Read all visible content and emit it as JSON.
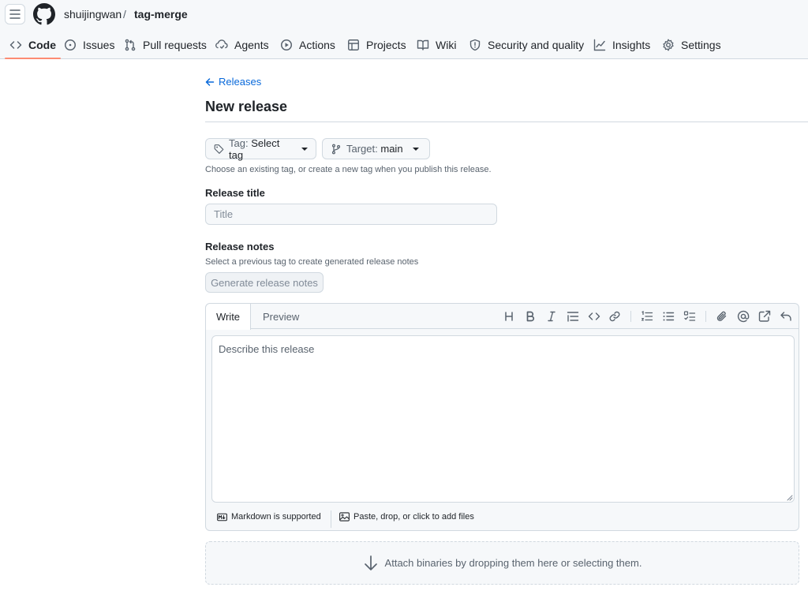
{
  "repo": {
    "owner": "shuijingwan",
    "separator": "/",
    "name": "tag-merge"
  },
  "nav": {
    "tabs": [
      {
        "label": "Code",
        "icon": "code-icon",
        "active": true
      },
      {
        "label": "Issues",
        "icon": "issue-icon"
      },
      {
        "label": "Pull requests",
        "icon": "pull-request-icon"
      },
      {
        "label": "Agents",
        "icon": "agents-icon"
      },
      {
        "label": "Actions",
        "icon": "play-icon"
      },
      {
        "label": "Projects",
        "icon": "table-icon"
      },
      {
        "label": "Wiki",
        "icon": "book-icon"
      },
      {
        "label": "Security and quality",
        "icon": "shield-icon"
      },
      {
        "label": "Insights",
        "icon": "graph-icon"
      },
      {
        "label": "Settings",
        "icon": "gear-icon"
      }
    ]
  },
  "page": {
    "back_label": "Releases",
    "title": "New release"
  },
  "tag_picker": {
    "prefix": "Tag:",
    "value": "Select tag"
  },
  "target_picker": {
    "prefix": "Target:",
    "value": "main"
  },
  "tag_hint": "Choose an existing tag, or create a new tag when you publish this release.",
  "release_title": {
    "label": "Release title",
    "placeholder": "Title",
    "value": ""
  },
  "release_notes": {
    "label": "Release notes",
    "hint": "Select a previous tag to create generated release notes",
    "generate_label": "Generate release notes"
  },
  "editor": {
    "tab_write": "Write",
    "tab_preview": "Preview",
    "placeholder": "Describe this release",
    "value": "",
    "toolbar": [
      "heading-icon",
      "bold-icon",
      "italic-icon",
      "quote-icon",
      "code-icon",
      "link-icon",
      "ordered-list-icon",
      "unordered-list-icon",
      "task-list-icon",
      "attach-icon",
      "mention-icon",
      "reference-icon",
      "undo-icon"
    ],
    "markdown_label": "Markdown is supported",
    "files_label": "Paste, drop, or click to add files"
  },
  "dropzone": {
    "label": "Attach binaries by dropping them here or selecting them."
  },
  "colors": {
    "accent_link": "#0969da",
    "active_tab_underline": "#fd8c73",
    "border": "#d1d9e0",
    "muted_text": "#59636e"
  }
}
